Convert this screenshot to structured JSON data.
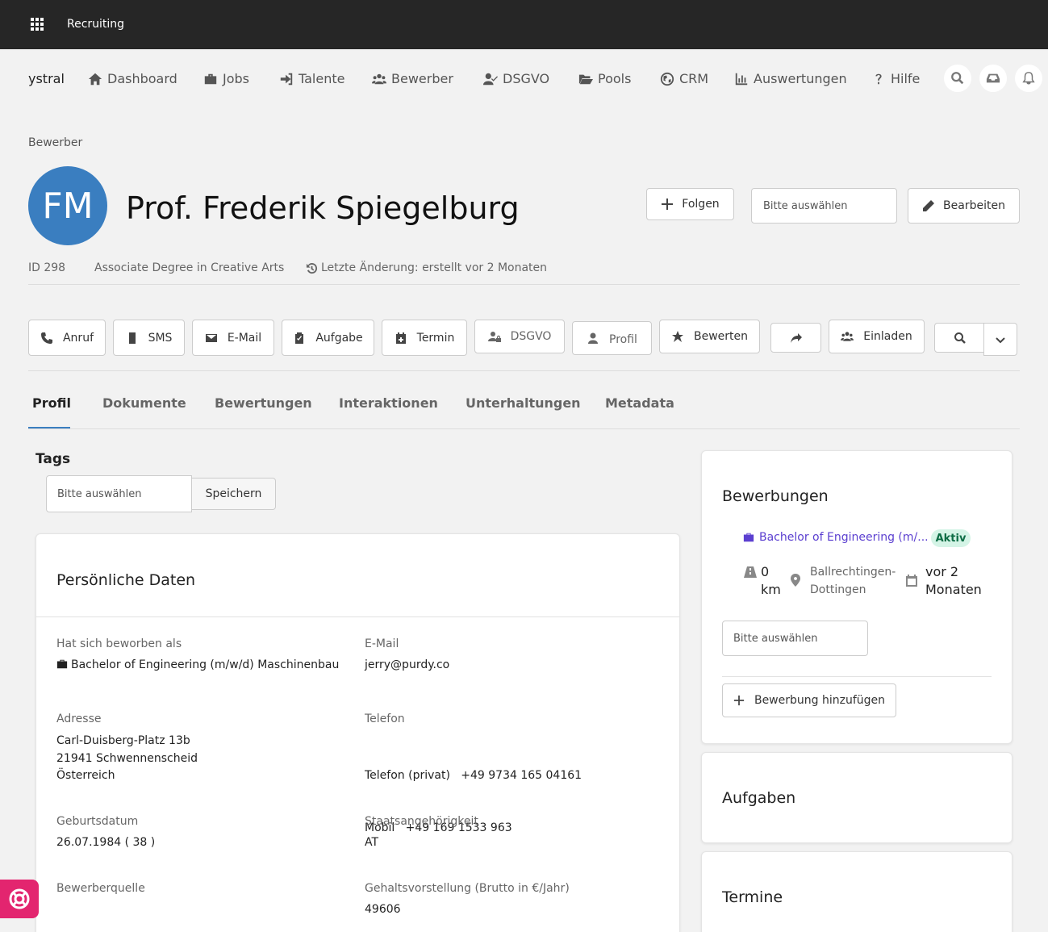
{
  "topbar": {
    "app_title": "Recruiting"
  },
  "nav": {
    "brand": "ystral",
    "items": [
      {
        "label": "Dashboard",
        "icon": "home-icon"
      },
      {
        "label": "Jobs",
        "icon": "briefcase-icon"
      },
      {
        "label": "Talente",
        "icon": "sign-in-icon"
      },
      {
        "label": "Bewerber",
        "icon": "users-icon"
      },
      {
        "label": "DSGVO",
        "icon": "user-check-icon"
      },
      {
        "label": "Pools",
        "icon": "folder-open-icon"
      },
      {
        "label": "CRM",
        "icon": "globe-icon"
      },
      {
        "label": "Auswertungen",
        "icon": "chart-icon"
      },
      {
        "label": "Hilfe",
        "icon": "question-icon"
      }
    ],
    "right_icons": [
      "search-icon",
      "inbox-icon",
      "bell-icon"
    ]
  },
  "breadcrumb": "Bewerber",
  "candidate": {
    "initials": "FM",
    "name": "Prof. Frederik Spiegelburg",
    "id": "ID 298",
    "degree": "Associate Degree in Creative Arts",
    "last_change": "Letzte Änderung: erstellt vor 2 Monaten"
  },
  "header_actions": {
    "follow": "Folgen",
    "select_placeholder": "Bitte auswählen",
    "edit": "Bearbeiten"
  },
  "actions": {
    "call": "Anruf",
    "sms": "SMS",
    "email": "E-Mail",
    "task": "Aufgabe",
    "appointment": "Termin",
    "gdpr": "DSGVO",
    "profile": "Profil",
    "rate": "Bewerten",
    "invite": "Einladen"
  },
  "tabs": [
    "Profil",
    "Dokumente",
    "Bewertungen",
    "Interaktionen",
    "Unterhaltungen",
    "Metadata"
  ],
  "tags": {
    "title": "Tags",
    "placeholder": "Bitte auswählen",
    "save": "Speichern"
  },
  "personal": {
    "title": "Persönliche Daten",
    "applied_as_label": "Hat sich beworben als",
    "applied_as": "Bachelor of Engineering (m/w/d) Maschinenbau",
    "email_label": "E-Mail",
    "email": "jerry@purdy.co",
    "address_label": "Adresse",
    "address_lines": [
      "Carl-Duisberg-Platz 13b",
      "21941 Schwennenscheid",
      "Österreich"
    ],
    "phone_label": "Telefon",
    "phone_lines": [
      "Telefon (privat)   +49 9734 165 04161",
      "Mobil   +49 169 1533 963"
    ],
    "birthdate_label": "Geburtsdatum",
    "birthdate": "26.07.1984 ( 38 )",
    "nationality_label": "Staatsangehörigkeit",
    "nationality": "AT",
    "source_label": "Bewerberquelle",
    "salary_label": "Gehaltsvorstellung (Brutto in €/Jahr)",
    "salary": "49606"
  },
  "applications": {
    "title": "Bewerbungen",
    "job_link": "Bachelor of Engineering (m/...",
    "status": "Aktiv",
    "distance_value": "0",
    "distance_unit": "km",
    "location_line1": "Ballrechtingen-",
    "location_line2": "Dottingen",
    "date_line1": "vor 2",
    "date_line2": "Monaten",
    "select_placeholder": "Bitte auswählen",
    "add_button": "Bewerbung hinzufügen"
  },
  "tasks": {
    "title": "Aufgaben"
  },
  "appointments": {
    "title": "Termine"
  },
  "colors": {
    "topbar": "#262626",
    "avatar": "#3a7ec0",
    "link": "#5b3fd0",
    "badge_bg": "#d4f4e6",
    "badge_text": "#0d6d45",
    "help_button": "#e3256f"
  }
}
